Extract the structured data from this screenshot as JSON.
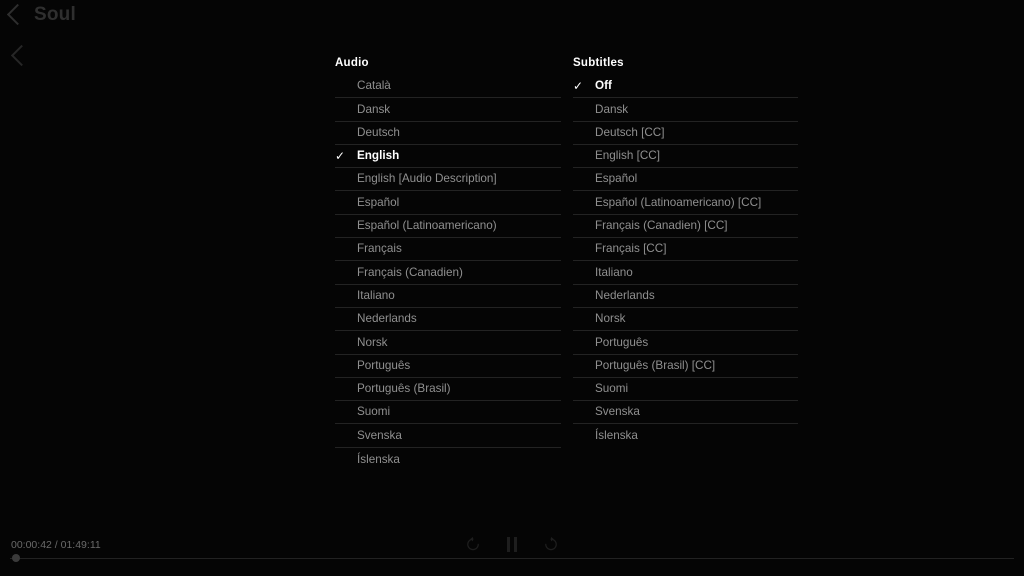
{
  "header": {
    "back_icon": "chevron-left-icon",
    "title": "Soul",
    "secondary_back_icon": "chevron-left-icon"
  },
  "audio": {
    "header": "Audio",
    "check_glyph": "✓",
    "options": [
      {
        "label": "Català",
        "selected": false
      },
      {
        "label": "Dansk",
        "selected": false
      },
      {
        "label": "Deutsch",
        "selected": false
      },
      {
        "label": "English",
        "selected": true
      },
      {
        "label": "English [Audio Description]",
        "selected": false
      },
      {
        "label": "Español",
        "selected": false
      },
      {
        "label": "Español (Latinoamericano)",
        "selected": false
      },
      {
        "label": "Français",
        "selected": false
      },
      {
        "label": "Français (Canadien)",
        "selected": false
      },
      {
        "label": "Italiano",
        "selected": false
      },
      {
        "label": "Nederlands",
        "selected": false
      },
      {
        "label": "Norsk",
        "selected": false
      },
      {
        "label": "Português",
        "selected": false
      },
      {
        "label": "Português (Brasil)",
        "selected": false
      },
      {
        "label": "Suomi",
        "selected": false
      },
      {
        "label": "Svenska",
        "selected": false
      },
      {
        "label": "Íslenska",
        "selected": false
      }
    ]
  },
  "subtitles": {
    "header": "Subtitles",
    "check_glyph": "✓",
    "options": [
      {
        "label": "Off",
        "selected": true
      },
      {
        "label": "Dansk",
        "selected": false
      },
      {
        "label": "Deutsch [CC]",
        "selected": false
      },
      {
        "label": "English [CC]",
        "selected": false
      },
      {
        "label": "Español",
        "selected": false
      },
      {
        "label": "Español (Latinoamericano) [CC]",
        "selected": false
      },
      {
        "label": "Français (Canadien) [CC]",
        "selected": false
      },
      {
        "label": "Français [CC]",
        "selected": false
      },
      {
        "label": "Italiano",
        "selected": false
      },
      {
        "label": "Nederlands",
        "selected": false
      },
      {
        "label": "Norsk",
        "selected": false
      },
      {
        "label": "Português",
        "selected": false
      },
      {
        "label": "Português (Brasil) [CC]",
        "selected": false
      },
      {
        "label": "Suomi",
        "selected": false
      },
      {
        "label": "Svenska",
        "selected": false
      },
      {
        "label": "Íslenska",
        "selected": false
      }
    ]
  },
  "player": {
    "timecode": "00:00:42 / 01:49:11",
    "current_time": "00:00:42",
    "duration": "01:49:11",
    "progress_percent": 0.6,
    "controls": {
      "rewind_icon": "rewind-10-icon",
      "rewind_label": "10",
      "pause_icon": "pause-icon",
      "forward_icon": "forward-10-icon",
      "forward_label": "10"
    }
  },
  "colors": {
    "background": "#050505",
    "divider": "#232323",
    "dim_text": "#909090",
    "selected_text": "#ffffff",
    "title_text": "#2f2f2f",
    "control_icon": "#1e1e1e",
    "timecode_text": "#6a6a6a",
    "scrubber_knob": "#3a3a3a"
  }
}
